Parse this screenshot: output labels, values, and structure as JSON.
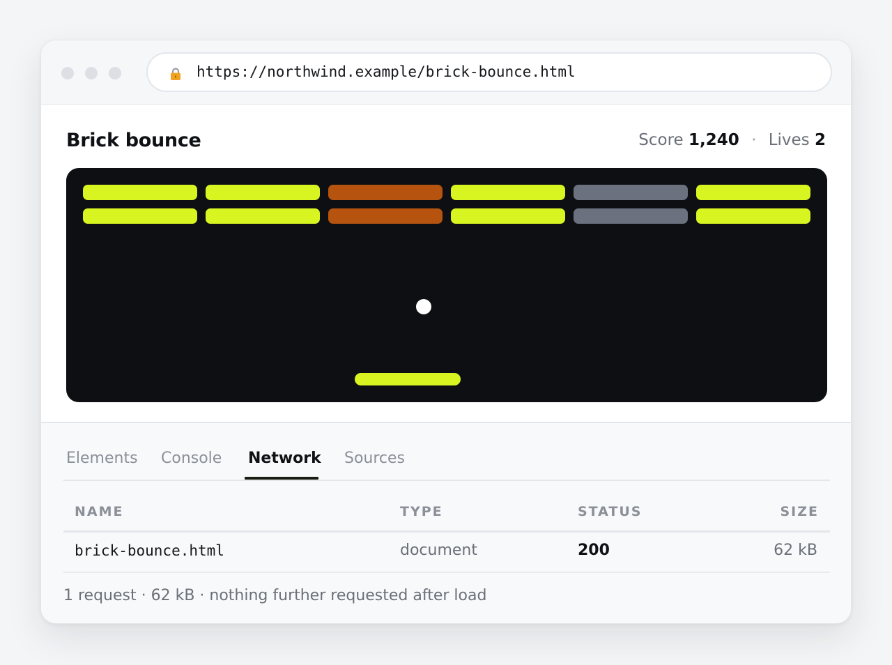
{
  "browser": {
    "url": "https://northwind.example/brick-bounce.html"
  },
  "game": {
    "title": "Brick bounce",
    "score_label": "Score",
    "score": "1,240",
    "separator": "·",
    "lives_label": "Lives",
    "lives": "2",
    "colors": {
      "board": "#0e0f12",
      "lime": "#d8f522",
      "orange": "#b5530f",
      "gray": "#6b717f",
      "ball": "#ffffff",
      "paddle": "#d8f522"
    },
    "bricks": [
      [
        "lime",
        "lime",
        "orange",
        "lime",
        "gray",
        "lime"
      ],
      [
        "lime",
        "lime",
        "orange",
        "lime",
        "gray",
        "lime"
      ]
    ]
  },
  "devtools": {
    "tabs": [
      {
        "label": "Elements",
        "active": false
      },
      {
        "label": "Console",
        "active": false
      },
      {
        "label": "Network",
        "active": true
      },
      {
        "label": "Sources",
        "active": false
      }
    ],
    "network": {
      "columns": {
        "name": "NAME",
        "type": "TYPE",
        "status": "STATUS",
        "size": "SIZE"
      },
      "rows": [
        {
          "name": "brick-bounce.html",
          "type": "document",
          "status": "200",
          "size": "62 kB"
        }
      ],
      "summary": "1 request · 62 kB · nothing further requested after load"
    }
  }
}
